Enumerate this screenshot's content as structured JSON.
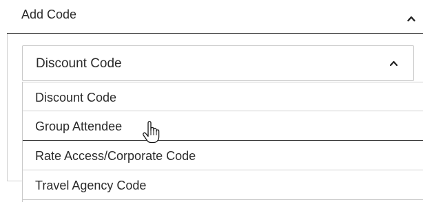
{
  "section": {
    "title": "Add Code",
    "chevron_icon": "chevron-up-icon"
  },
  "select": {
    "value": "Discount Code",
    "chevron_icon": "chevron-up-icon",
    "expanded": true
  },
  "options": [
    {
      "label": "Discount Code"
    },
    {
      "label": "Group Attendee"
    },
    {
      "label": "Rate Access/Corporate Code"
    },
    {
      "label": "Travel Agency Code"
    }
  ],
  "hovered_option": "Group Attendee",
  "cursor_icon": "hand-pointer-icon",
  "colors": {
    "text": "#2b2b2b",
    "border": "#c9c9c9",
    "header_rule": "#333333"
  }
}
